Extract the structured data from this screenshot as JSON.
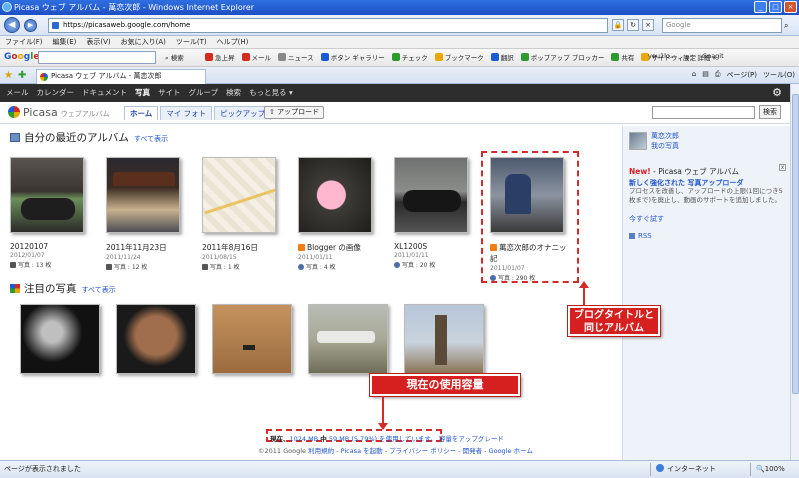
{
  "window": {
    "title": "Picasa ウェブ アルバム - 萬恋次郎 - Windows Internet Explorer",
    "url": "https://picasaweb.google.com/home",
    "search_placeholder": "Google"
  },
  "menubar": [
    "ファイル(F)",
    "編集(E)",
    "表示(V)",
    "お気に入り(A)",
    "ツール(T)",
    "ヘルプ(H)"
  ],
  "google_toolbar": {
    "logo": [
      "G",
      "o",
      "o",
      "g",
      "l",
      "e"
    ],
    "search_label": "検索",
    "tools": [
      "急上昇",
      "メール",
      "ニュース",
      "ボタン ギャラリー",
      "チェック",
      "ブックマーク",
      "翻訳",
      "ポップアップ ブロッカー",
      "共有",
      "サイドウィキ",
      "詳細 »"
    ],
    "right": [
      "you1lo...",
      "設定",
      "Snagit"
    ]
  },
  "tab": {
    "label": "Picasa ウェブ アルバム - 萬恋次郎"
  },
  "command_bar": [
    "ページ(P)",
    "ツール(O)"
  ],
  "google_bar": {
    "items": [
      "メール",
      "カレンダー",
      "ドキュメント",
      "写真",
      "サイト",
      "グループ",
      "検索",
      "もっと見る ▾"
    ],
    "active": "写真"
  },
  "picasa": {
    "logo": "Picasa",
    "subtitle": "ウェブアルバム",
    "tabs": [
      "ホーム",
      "マイ フォト",
      "ピックアップ"
    ],
    "active_tab": "ホーム",
    "upload_label": "アップロード",
    "search_button": "検索"
  },
  "recent_section": {
    "title": "自分の最近のアルバム",
    "show_all": "すべて表示"
  },
  "albums": [
    {
      "name": "20120107",
      "date": "2012/01/07",
      "meta": "写真 : 13 枚",
      "img": "img-moto1",
      "blog": false,
      "privacy": "lock"
    },
    {
      "name": "2011年11月23日",
      "date": "2011/11/24",
      "meta": "写真 : 12 枚",
      "img": "img-shrine",
      "blog": false,
      "privacy": "lock"
    },
    {
      "name": "2011年8月16日",
      "date": "2011/08/15",
      "meta": "写真 : 1 枚",
      "img": "img-map",
      "blog": false,
      "privacy": "lock"
    },
    {
      "name": "Blogger の画像",
      "date": "2011/01/11",
      "meta": "写真 : 4 枚",
      "img": "img-skull",
      "blog": true,
      "privacy": "globe"
    },
    {
      "name": "XL1200S",
      "date": "2011/01/11",
      "meta": "写真 : 20 枚",
      "img": "img-xl",
      "blog": false,
      "privacy": "globe"
    },
    {
      "name": "萬恋次郎のオナニッ",
      "name2": "記",
      "date": "2011/01/07",
      "meta": "写真 : 290 枚",
      "img": "img-owner",
      "blog": true,
      "privacy": "globe"
    }
  ],
  "featured_section": {
    "title": "注目の写真",
    "show_all": "すべて表示"
  },
  "featured": [
    "img-concert",
    "img-man",
    "img-sea",
    "img-plane",
    "img-tower"
  ],
  "callouts": {
    "blog_album": [
      "ブログタイトルと",
      "同じアルバム"
    ],
    "storage": "現在の使用容量"
  },
  "sidebar": {
    "user_name": "萬恋次郎",
    "photos_link": "我の写真",
    "new_label": "New!",
    "new_source": "Picasa ウェブ アルバム",
    "headline": "新しく強化された 写真アップローダ",
    "body": "プロセスを改善し、アップロードの上限(1回につき5枚まで)を廃止し、動画のサポートを追加しました。",
    "try_link": "今すぐ試す",
    "rss": "RSS",
    "close": "x"
  },
  "footer": {
    "storage_prefix": "現在、",
    "storage_used": "1024 MB",
    "storage_mid": "中",
    "storage_detail": "59 MB (5.79%) を使用しています。",
    "upgrade": "容量をアップグレード",
    "copyright": "©2011 Google",
    "links": [
      "利用規約",
      "Picasa を起動",
      "プライバシー ポリシー",
      "開発者",
      "Google ホーム"
    ]
  },
  "statusbar": {
    "text": "ページが表示されました",
    "zone": "インターネット",
    "zoom": "100%"
  }
}
